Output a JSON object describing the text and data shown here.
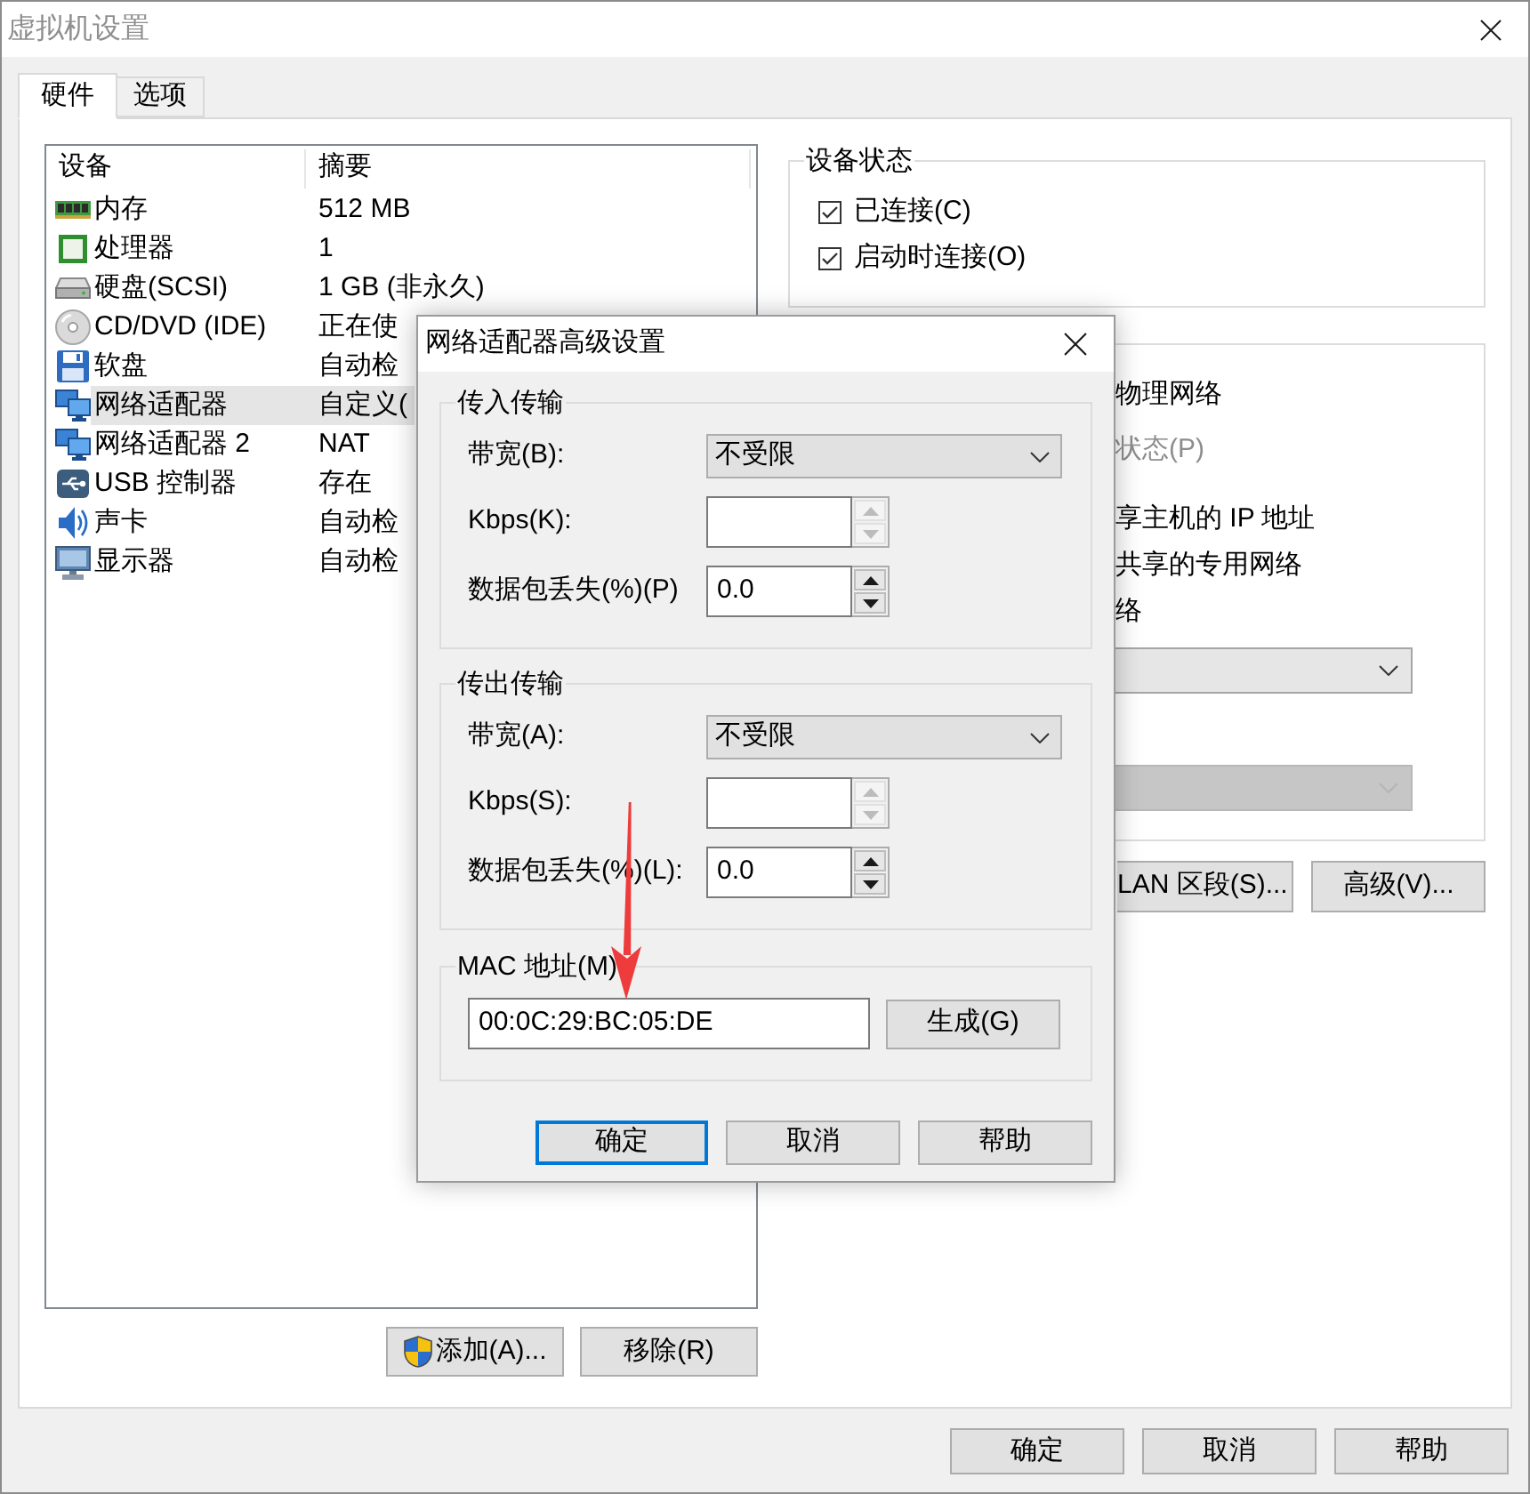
{
  "window": {
    "title": "虚拟机设置"
  },
  "tabs": [
    {
      "label": "硬件",
      "selected": true
    },
    {
      "label": "选项",
      "selected": false
    }
  ],
  "device_list": {
    "columns": [
      "设备",
      "摘要"
    ],
    "rows": [
      {
        "kind": "memory",
        "device": "内存",
        "summary": "512 MB",
        "selected": false
      },
      {
        "kind": "processor",
        "device": "处理器",
        "summary": "1",
        "selected": false
      },
      {
        "kind": "hard_disk",
        "device": "硬盘(SCSI)",
        "summary": "1 GB (非永久)",
        "selected": false
      },
      {
        "kind": "cd_dvd",
        "device": "CD/DVD (IDE)",
        "summary": "正在使",
        "selected": false
      },
      {
        "kind": "floppy",
        "device": "软盘",
        "summary": "自动检",
        "selected": false
      },
      {
        "kind": "network",
        "device": "网络适配器",
        "summary": "自定义(",
        "selected": true
      },
      {
        "kind": "network",
        "device": "网络适配器 2",
        "summary": "NAT",
        "selected": false
      },
      {
        "kind": "usb",
        "device": "USB 控制器",
        "summary": "存在",
        "selected": false
      },
      {
        "kind": "sound",
        "device": "声卡",
        "summary": "自动检",
        "selected": false
      },
      {
        "kind": "display",
        "device": "显示器",
        "summary": "自动检",
        "selected": false
      }
    ]
  },
  "device_buttons": [
    {
      "kind": "elevated",
      "label": "添加(A)..."
    },
    {
      "kind": "normal",
      "label": "移除(R)"
    }
  ],
  "device_status": {
    "title": "设备状态",
    "options": [
      {
        "label": "已连接(C)",
        "checked": true
      },
      {
        "label": "启动时连接(O)",
        "checked": true
      }
    ]
  },
  "network_connection": {
    "options": [
      {
        "label": "物理网络",
        "disabled": false
      },
      {
        "label": "状态(P)",
        "disabled": true
      },
      {
        "label": "享主机的 IP 地址",
        "disabled": false
      },
      {
        "label": "共享的专用网络",
        "disabled": false
      },
      {
        "label": "络",
        "disabled": false
      }
    ],
    "dropdowns": [
      {
        "disabled": false
      },
      {
        "disabled": true
      }
    ],
    "buttons": [
      "LAN 区段(S)...",
      "高级(V)..."
    ]
  },
  "dialog": {
    "title": "网络适配器高级设置",
    "groups": [
      {
        "title": "传入传输",
        "fields": [
          {
            "kind": "dropdown",
            "label": "带宽(B):",
            "value": "不受限"
          },
          {
            "kind": "spinner",
            "label": "Kbps(K):",
            "disabled": true
          },
          {
            "kind": "spinner",
            "label": "数据包丢失(%)(P)",
            "value": "0.0",
            "disabled": false
          }
        ]
      },
      {
        "title": "传出传输",
        "fields": [
          {
            "kind": "dropdown",
            "label": "带宽(A):",
            "value": "不受限"
          },
          {
            "kind": "spinner",
            "label": "Kbps(S):",
            "disabled": true
          },
          {
            "kind": "spinner",
            "label": "数据包丢失(%)(L):",
            "value": "0.0",
            "disabled": false
          }
        ]
      }
    ],
    "mac_address": {
      "title": "MAC 地址(M)",
      "value": "00:0C:29:BC:05:DE",
      "button": "生成(G)"
    },
    "buttons": [
      {
        "label": "确定",
        "default": true
      },
      {
        "label": "取消",
        "default": false
      },
      {
        "label": "帮助",
        "default": false
      }
    ]
  },
  "buttons": [
    "确定",
    "取消",
    "帮助"
  ]
}
